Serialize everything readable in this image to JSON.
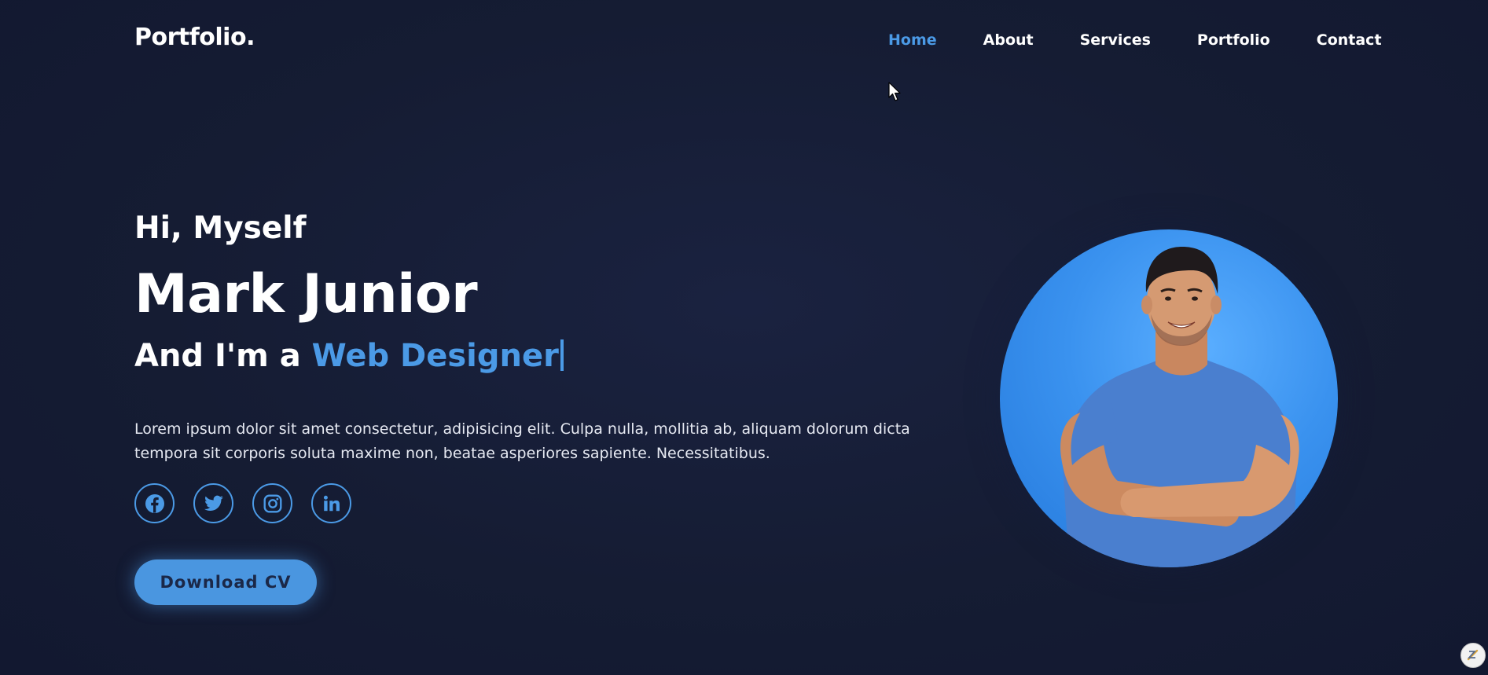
{
  "header": {
    "logo": "Portfolio.",
    "nav": [
      {
        "label": "Home",
        "active": true
      },
      {
        "label": "About",
        "active": false
      },
      {
        "label": "Services",
        "active": false
      },
      {
        "label": "Portfolio",
        "active": false
      },
      {
        "label": "Contact",
        "active": false
      }
    ]
  },
  "hero": {
    "greeting": "Hi, Myself",
    "name": "Mark Junior",
    "role_prefix": "And I'm a ",
    "role_highlight": "Web Designer",
    "description": "Lorem ipsum dolor sit amet consectetur, adipisicing elit. Culpa nulla, mollitia ab, aliquam dolorum dicta tempora sit corporis soluta maxime non, beatae asperiores sapiente. Necessitatibus.",
    "socials": [
      {
        "icon": "facebook-icon"
      },
      {
        "icon": "twitter-icon"
      },
      {
        "icon": "instagram-icon"
      },
      {
        "icon": "linkedin-icon"
      }
    ],
    "button_label": "Download CV"
  },
  "colors": {
    "background": "#151c33",
    "accent": "#4b9ae6",
    "text": "#ffffff"
  }
}
